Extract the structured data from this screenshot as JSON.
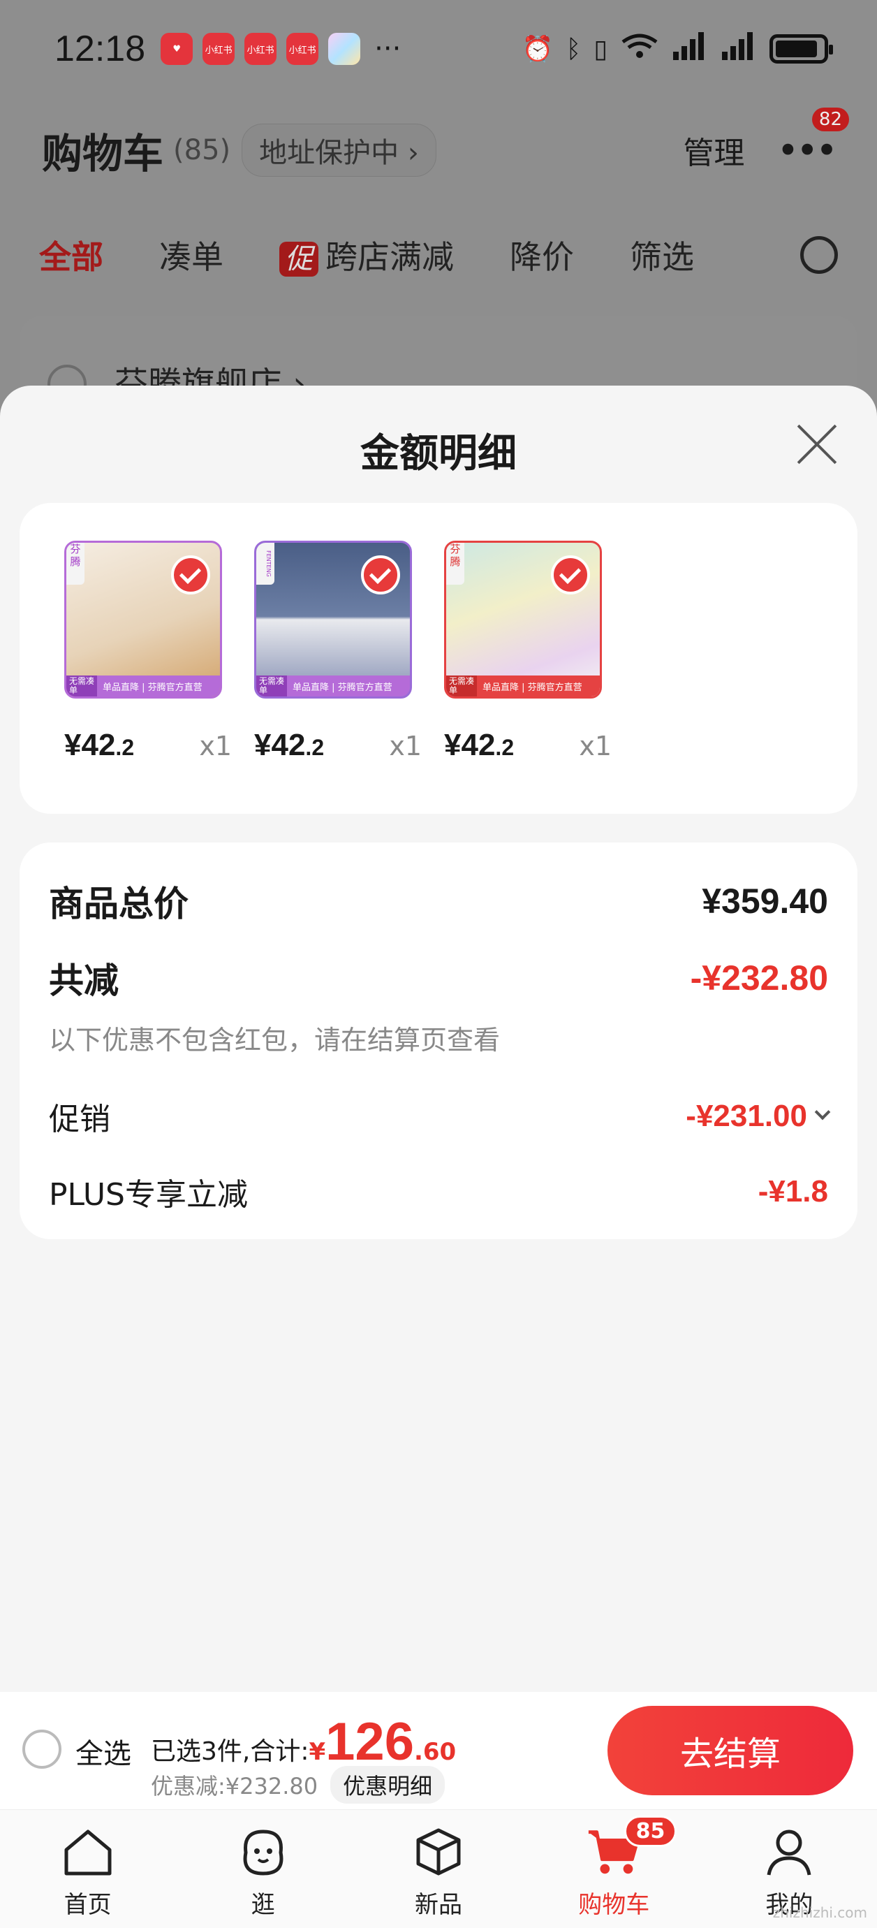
{
  "status_bar": {
    "time": "12:18",
    "notification_apps": [
      "小红书",
      "小红书",
      "小红书"
    ],
    "more": "···",
    "battery_level": 0.9
  },
  "cart_header": {
    "title": "购物车",
    "count": "(85)",
    "address_protection": "地址保护中 ›",
    "manage": "管理",
    "more_badge": "82"
  },
  "tabs": [
    {
      "label": "全部",
      "active": true
    },
    {
      "label": "凑单"
    },
    {
      "label": "跨店满减",
      "tag": "促"
    },
    {
      "label": "降价"
    },
    {
      "label": "筛选"
    }
  ],
  "shop_name": "芬腾旗舰店 ›",
  "sheet": {
    "title": "金额明细",
    "items": [
      {
        "price_int": "¥42",
        "price_dec": ".2",
        "qty": "x1",
        "brand": "芬腾",
        "tag": "无需凑单",
        "strip": "单品直降 | 芬腾官方直营"
      },
      {
        "price_int": "¥42",
        "price_dec": ".2",
        "qty": "x1",
        "brand": "FENTENG",
        "tag": "无需凑单",
        "strip": "单品直降 | 芬腾官方直营"
      },
      {
        "price_int": "¥42",
        "price_dec": ".2",
        "qty": "x1",
        "brand": "芬腾",
        "tag": "无需凑单",
        "strip": "单品直降 | 芬腾官方直营"
      }
    ],
    "summary": {
      "total_label": "商品总价",
      "total_value": "¥359.40",
      "reduce_label": "共减",
      "reduce_value": "-¥232.80",
      "note": "以下优惠不包含红包，请在结算页查看",
      "promo_label": "促销",
      "promo_value": "-¥231.00",
      "plus_label": "PLUS专享立减",
      "plus_value": "-¥1.8"
    }
  },
  "checkout": {
    "select_all": "全选",
    "selected_prefix": "已选3件,合计:",
    "currency": "¥",
    "total_int": "126",
    "total_dec": ".60",
    "discount": "优惠减:¥232.80",
    "detail": "优惠明细",
    "button": "去结算"
  },
  "bottom_nav": [
    {
      "label": "首页",
      "icon": "home-icon"
    },
    {
      "label": "逛",
      "icon": "explore-icon"
    },
    {
      "label": "新品",
      "icon": "cube-icon"
    },
    {
      "label": "购物车",
      "icon": "cart-icon",
      "active": true,
      "badge": "85"
    },
    {
      "label": "我的",
      "icon": "user-icon"
    }
  ],
  "colors": {
    "accent": "#e8332c",
    "sheet_bg": "#f5f5f5"
  },
  "watermark": "zhizhizhi.com"
}
